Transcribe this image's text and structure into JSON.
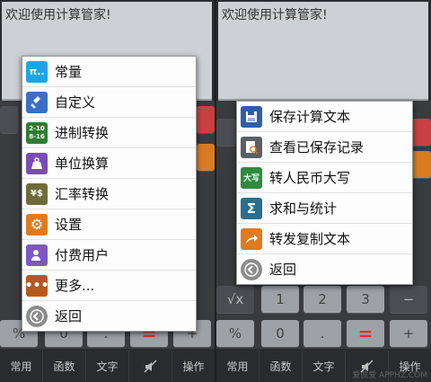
{
  "left": {
    "display_text": "欢迎使用计算管家!",
    "bottom_bar": [
      "常用",
      "函数",
      "文字",
      "操作"
    ],
    "visible_keys": [
      "%",
      "0",
      ".",
      "=",
      "+"
    ],
    "menu": [
      {
        "label": "常量",
        "icon": "pi-icon",
        "color": "#1da5e3"
      },
      {
        "label": "自定义",
        "icon": "broom-icon",
        "color": "#3a6fc4"
      },
      {
        "label": "进制转换",
        "icon": "base-convert-icon",
        "color": "#2e7d32"
      },
      {
        "label": "单位换算",
        "icon": "weight-icon",
        "color": "#7a4bb5"
      },
      {
        "label": "汇率转换",
        "icon": "yen-dollar-icon",
        "color": "#6d6b3a"
      },
      {
        "label": "设置",
        "icon": "gear-icon",
        "color": "#e07a1f"
      },
      {
        "label": "付费用户",
        "icon": "user-icon",
        "color": "#7b58c2"
      },
      {
        "label": "更多...",
        "icon": "more-icon",
        "color": "#b5581e"
      },
      {
        "label": "返回",
        "icon": "back-icon",
        "color": "#8c8c8c"
      }
    ]
  },
  "right": {
    "display_text": "欢迎使用计算管家!",
    "bottom_bar": [
      "常用",
      "函数",
      "文字",
      "操作"
    ],
    "visible_keys": [
      "√x",
      "1",
      "2",
      "3",
      "−",
      "%",
      "0",
      ".",
      "=",
      "+"
    ],
    "menu": [
      {
        "label": "保存计算文本",
        "icon": "floppy-icon",
        "color": "#2f5ea8"
      },
      {
        "label": "查看已保存记录",
        "icon": "document-search-icon",
        "color": "#5b5f66"
      },
      {
        "label": "转人民币大写",
        "icon": "daxie-icon",
        "color": "#2e8b3f",
        "text": "大写"
      },
      {
        "label": "求和与统计",
        "icon": "sigma-icon",
        "color": "#2a6f8f"
      },
      {
        "label": "转发复制文本",
        "icon": "share-icon",
        "color": "#e07a1f"
      },
      {
        "label": "返回",
        "icon": "back-icon",
        "color": "#8c8c8c"
      }
    ]
  },
  "watermark": "爱就爱 APPHZ.COM"
}
